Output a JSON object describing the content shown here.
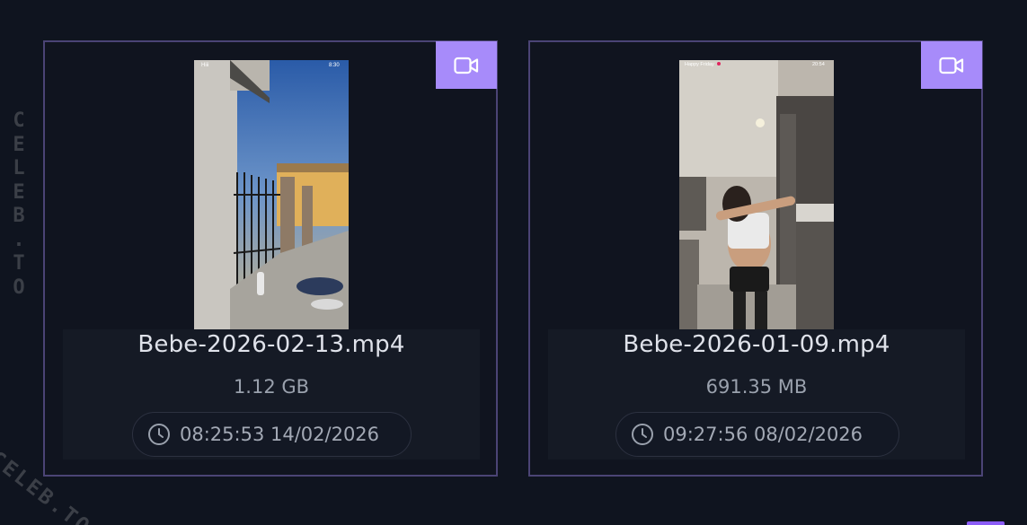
{
  "watermark": {
    "vertical_letters": [
      "C",
      "E",
      "L",
      "E",
      "B",
      ".",
      "T",
      "O"
    ],
    "diagonal_text": "CELEB.TO"
  },
  "cards": [
    {
      "type_icon": "video-camera-icon",
      "file_name": "Bebe-2026-02-13.mp4",
      "file_size": "1.12 GB",
      "date_icon": "clock-icon",
      "timestamp": "08:25:53 14/02/2026",
      "thumb_status_left": "Hiii",
      "thumb_status_right": "8:30"
    },
    {
      "type_icon": "video-camera-icon",
      "file_name": "Bebe-2026-01-09.mp4",
      "file_size": "691.35 MB",
      "date_icon": "clock-icon",
      "timestamp": "09:27:56 08/02/2026",
      "thumb_status_left": "Happy Friday",
      "thumb_status_right": "20:54"
    }
  ],
  "colors": {
    "background": "#0f141f",
    "card_border": "#4b4475",
    "badge": "#a78bfa",
    "accent": "#8b5cf6"
  }
}
